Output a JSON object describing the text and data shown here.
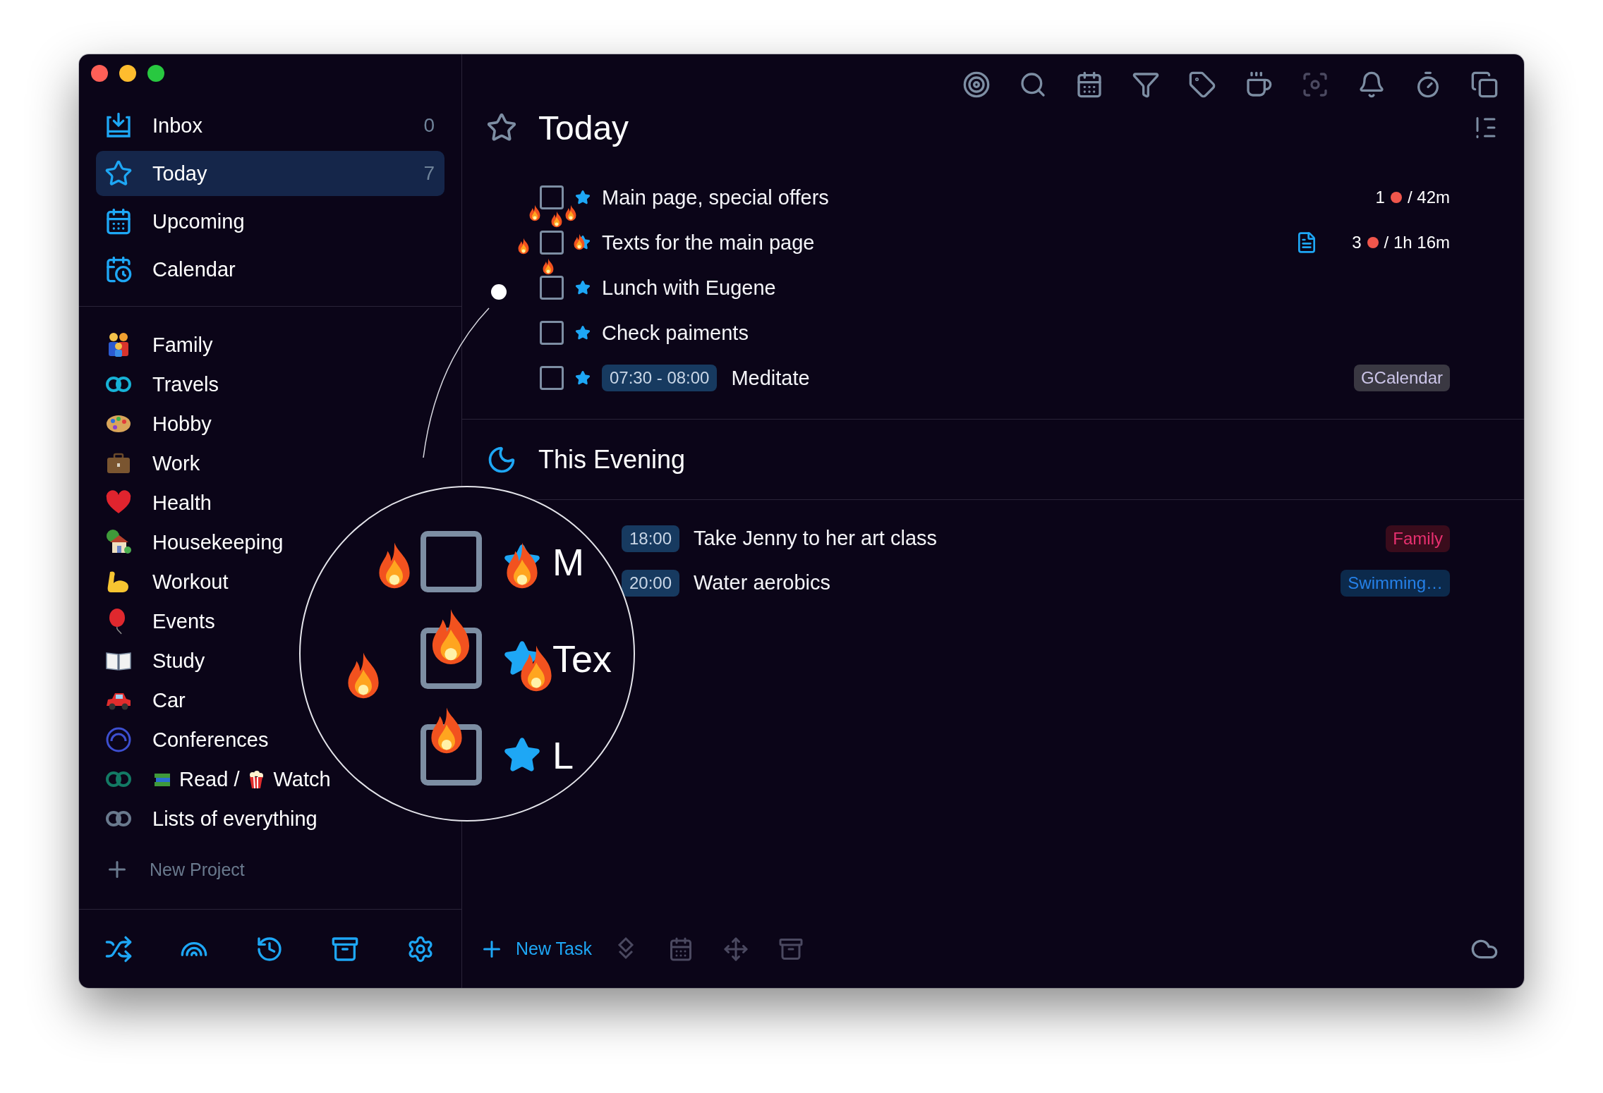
{
  "sidebar": {
    "nav": [
      {
        "kind": "inbox",
        "label": "Inbox",
        "count": "0",
        "selected": false
      },
      {
        "kind": "today",
        "label": "Today",
        "count": "7",
        "selected": true
      },
      {
        "kind": "upcoming",
        "label": "Upcoming",
        "selected": false
      },
      {
        "kind": "calendar",
        "label": "Calendar",
        "selected": false
      }
    ],
    "projects": [
      {
        "kind": "family",
        "label": "Family"
      },
      {
        "kind": "rings",
        "label": "Travels",
        "color": "#17b2d6"
      },
      {
        "kind": "palette",
        "label": "Hobby"
      },
      {
        "kind": "briefcase",
        "label": "Work"
      },
      {
        "kind": "heart",
        "label": "Health"
      },
      {
        "kind": "house",
        "label": "Housekeeping"
      },
      {
        "kind": "muscle",
        "label": "Workout"
      },
      {
        "kind": "balloon",
        "label": "Events"
      },
      {
        "kind": "book",
        "label": "Study"
      },
      {
        "kind": "car",
        "label": "Car"
      },
      {
        "kind": "arc",
        "label": "Conferences",
        "color": "#3d4fd0"
      },
      {
        "kind": "rings",
        "color": "#137a64",
        "segments": [
          {
            "text": "Read /"
          },
          {
            "text": "Watch"
          }
        ]
      },
      {
        "kind": "rings",
        "label": "Lists of everything",
        "color": "#6a7a8e"
      }
    ],
    "new_project": "New Project"
  },
  "today": {
    "title": "Today",
    "tasks": [
      {
        "title": "Main page, special offers",
        "checked": false,
        "note": false,
        "pomodoros": "1",
        "duration": "/ 42m"
      },
      {
        "title": "Texts for the main page",
        "checked": false,
        "note": true,
        "pomodoros": "3",
        "duration": "/ 1h 16m"
      },
      {
        "title": "Lunch with Eugene",
        "checked": false,
        "note": false
      },
      {
        "title": "Check paiments",
        "checked": false,
        "note": false
      },
      {
        "title": "Meditate",
        "checked": false,
        "note": false,
        "time": "07:30 - 08:00",
        "tag": {
          "label": "GCalendar",
          "color": "#3a3842"
        }
      }
    ]
  },
  "evening": {
    "title": "This Evening",
    "tasks": [
      {
        "title": "Take Jenny to her art class",
        "time": "18:00",
        "tag": {
          "label": "Family",
          "color": "#3a0c1c"
        }
      },
      {
        "title": "Water aerobics",
        "time": "20:00",
        "tag": {
          "label": "Swimming…",
          "color": "#0c2a4c"
        }
      }
    ]
  },
  "lens": {
    "rows": [
      {
        "text": "M",
        "checked": false
      },
      {
        "text": "Tex",
        "checked": false
      },
      {
        "text": "L",
        "checked": false
      }
    ]
  },
  "footer": {
    "new_task": "New Task"
  }
}
